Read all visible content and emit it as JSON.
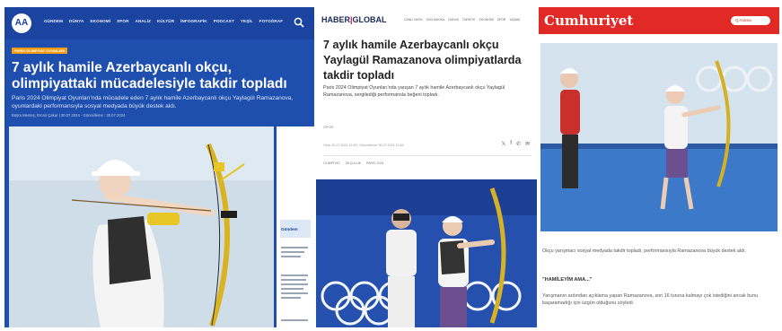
{
  "panel_aa": {
    "logo": "AA",
    "menu": [
      "GÜNDEM",
      "DÜNYA",
      "EKONOMİ",
      "SPOR",
      "ANALİZ",
      "KÜLTÜR",
      "İNFOGRAFİK",
      "PODCAST",
      "YEŞİL",
      "FOTOĞRAF"
    ],
    "category_tag": "PARİS OLİMPİYAT OYUNLARI",
    "headline": "7 aylık hamile Azerbaycanlı okçu, olimpiyattaki mücadelesiyle takdir topladı",
    "lead": "Paris 2024 Olimpiyat Oyunları'nda mücadele eden 7 aylık hamile Azerbaycanlı okçu Yaylagül Ramazanova, oyunlardaki performansıyla sosyal medyada büyük destek aldı.",
    "meta": "Büşra Menteş, Ercan Çakar | 30.07.2024 - Güncelleme : 30.07.2024",
    "side_title": "Gündem"
  },
  "panel_haber": {
    "logo_left": "HABER",
    "logo_right": "GLOBAL",
    "menu": [
      "CANLI YAYIN",
      "SON DAKİKA",
      "DÜNYA",
      "TÜRKİYE",
      "EKONOMİ",
      "SPOR",
      "YAŞAM"
    ],
    "headline": "7 aylık hamile Azerbaycanlı okçu Yaylagül Ramazanova olimpiyatlarda takdir topladı",
    "lead": "Paris 2024 Olimpiyat Oyunları'nda yarışan 7 aylık hamile Azerbaycanlı okçu Yaylagül Ramazanova, sergilediği performansla beğeni topladı.",
    "meta": "SPOR",
    "meta2": "Giriş: 30.07.2024 12:45 | Güncelleme: 30.07.2024 12:48",
    "share": [
      "𝕏",
      "f",
      "✆",
      "✉"
    ],
    "tags": [
      "OLİMPİYAT",
      "OKÇULUK",
      "PARİS 2024"
    ]
  },
  "panel_cumhuriyet": {
    "logo": "Cumhuriyet",
    "search_label": "Q Arama",
    "lead": "Okçu yarışmacı sosyal medyada takdir topladı; performansıyla Ramazanova büyük destek aldı.",
    "subheading": "\"HAMİLEYİM AMA...\"",
    "body": "Yarışmanın ardından açıklama yapan Ramazanova, son 16 turuna kalmayı çok istediğini ancak bunu başaramadığı için üzgün olduğunu söyledi."
  }
}
